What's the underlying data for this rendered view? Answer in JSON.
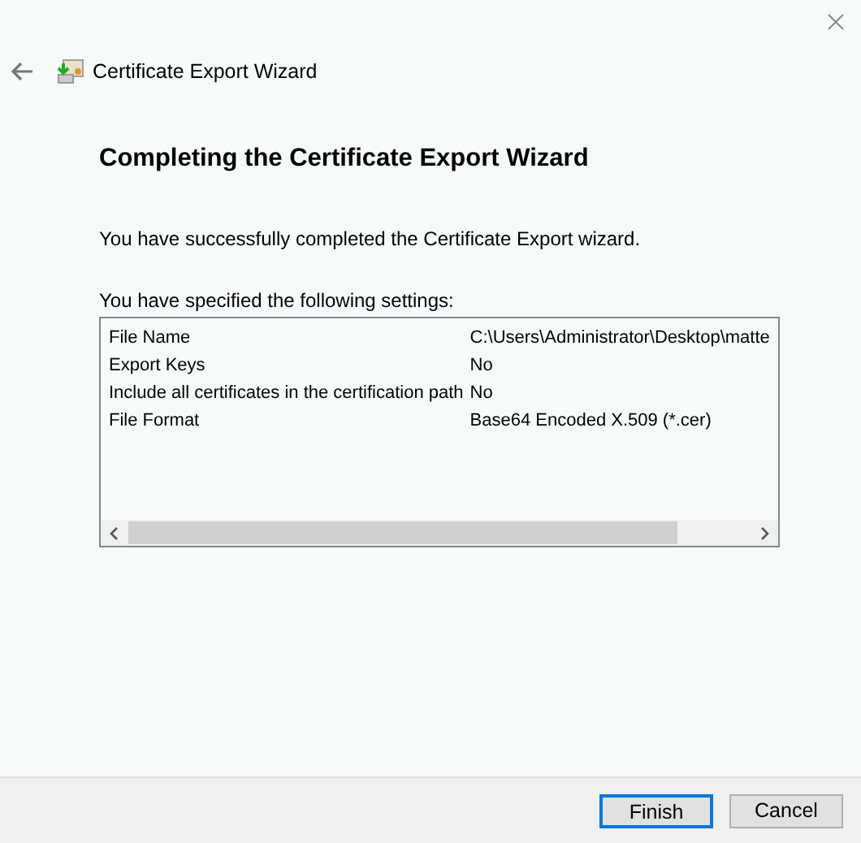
{
  "window": {
    "title": "Certificate Export Wizard"
  },
  "heading": "Completing the Certificate Export Wizard",
  "message": "You have successfully completed the Certificate Export wizard.",
  "settings_label": "You have specified the following settings:",
  "settings": [
    {
      "name": "File Name",
      "value": "C:\\Users\\Administrator\\Desktop\\matte"
    },
    {
      "name": "Export Keys",
      "value": "No"
    },
    {
      "name": "Include all certificates in the certification path",
      "value": "No"
    },
    {
      "name": "File Format",
      "value": "Base64 Encoded X.509 (*.cer)"
    }
  ],
  "buttons": [
    {
      "label": "Finish",
      "default": true
    },
    {
      "label": "Cancel",
      "default": false
    }
  ]
}
